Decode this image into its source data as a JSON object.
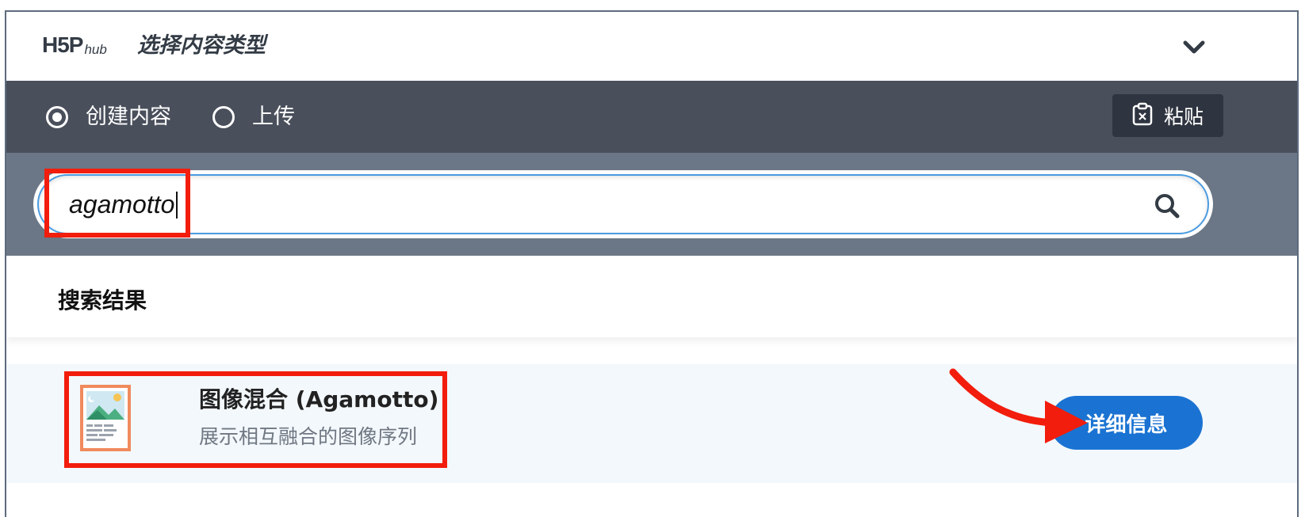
{
  "header": {
    "logo_mark": "H5P",
    "logo_sub": "hub",
    "title": "选择内容类型",
    "collapse_icon": "chevron-down-icon"
  },
  "tabs": {
    "create_label": "创建内容",
    "upload_label": "上传",
    "selected": "create",
    "paste_label": "粘贴",
    "paste_icon": "clipboard-icon"
  },
  "search": {
    "value": "agamotto",
    "icon": "search-icon"
  },
  "results": {
    "title": "搜索结果",
    "items": [
      {
        "name": "图像混合 (Agamotto)",
        "description": "展示相互融合的图像序列",
        "icon": "image-blend-icon",
        "details_label": "详细信息"
      }
    ]
  },
  "colors": {
    "annotation": "#f21d0c",
    "accent": "#1a73d2",
    "tabbar": "#494f5b",
    "searchband": "#6b7786"
  }
}
